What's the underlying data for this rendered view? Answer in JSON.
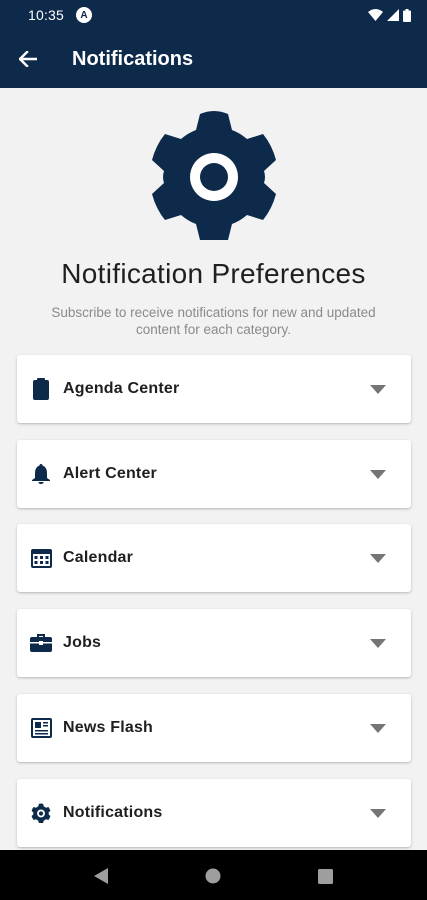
{
  "status_bar": {
    "time": "10:35",
    "badge_letter": "A",
    "icons": [
      "wifi-icon",
      "signal-icon",
      "battery-icon"
    ]
  },
  "app_bar": {
    "title": "Notifications",
    "back_icon": "arrow-left-icon"
  },
  "hero": {
    "icon": "gear-icon",
    "heading": "Notification Preferences",
    "subtitle": "Subscribe to receive notifications for new and updated content for each category."
  },
  "categories": [
    {
      "label": "Agenda Center",
      "icon": "clipboard-icon"
    },
    {
      "label": "Alert Center",
      "icon": "bell-icon"
    },
    {
      "label": "Calendar",
      "icon": "calendar-icon"
    },
    {
      "label": "Jobs",
      "icon": "briefcase-icon"
    },
    {
      "label": "News Flash",
      "icon": "newspaper-icon"
    },
    {
      "label": "Notifications",
      "icon": "gear-icon"
    }
  ],
  "nav_bar": {
    "buttons": [
      "back-triangle-icon",
      "home-circle-icon",
      "recents-square-icon"
    ]
  },
  "colors": {
    "brand": "#0d2a4a",
    "background": "#f2f2f2",
    "card": "#ffffff",
    "chevron": "#757575"
  }
}
